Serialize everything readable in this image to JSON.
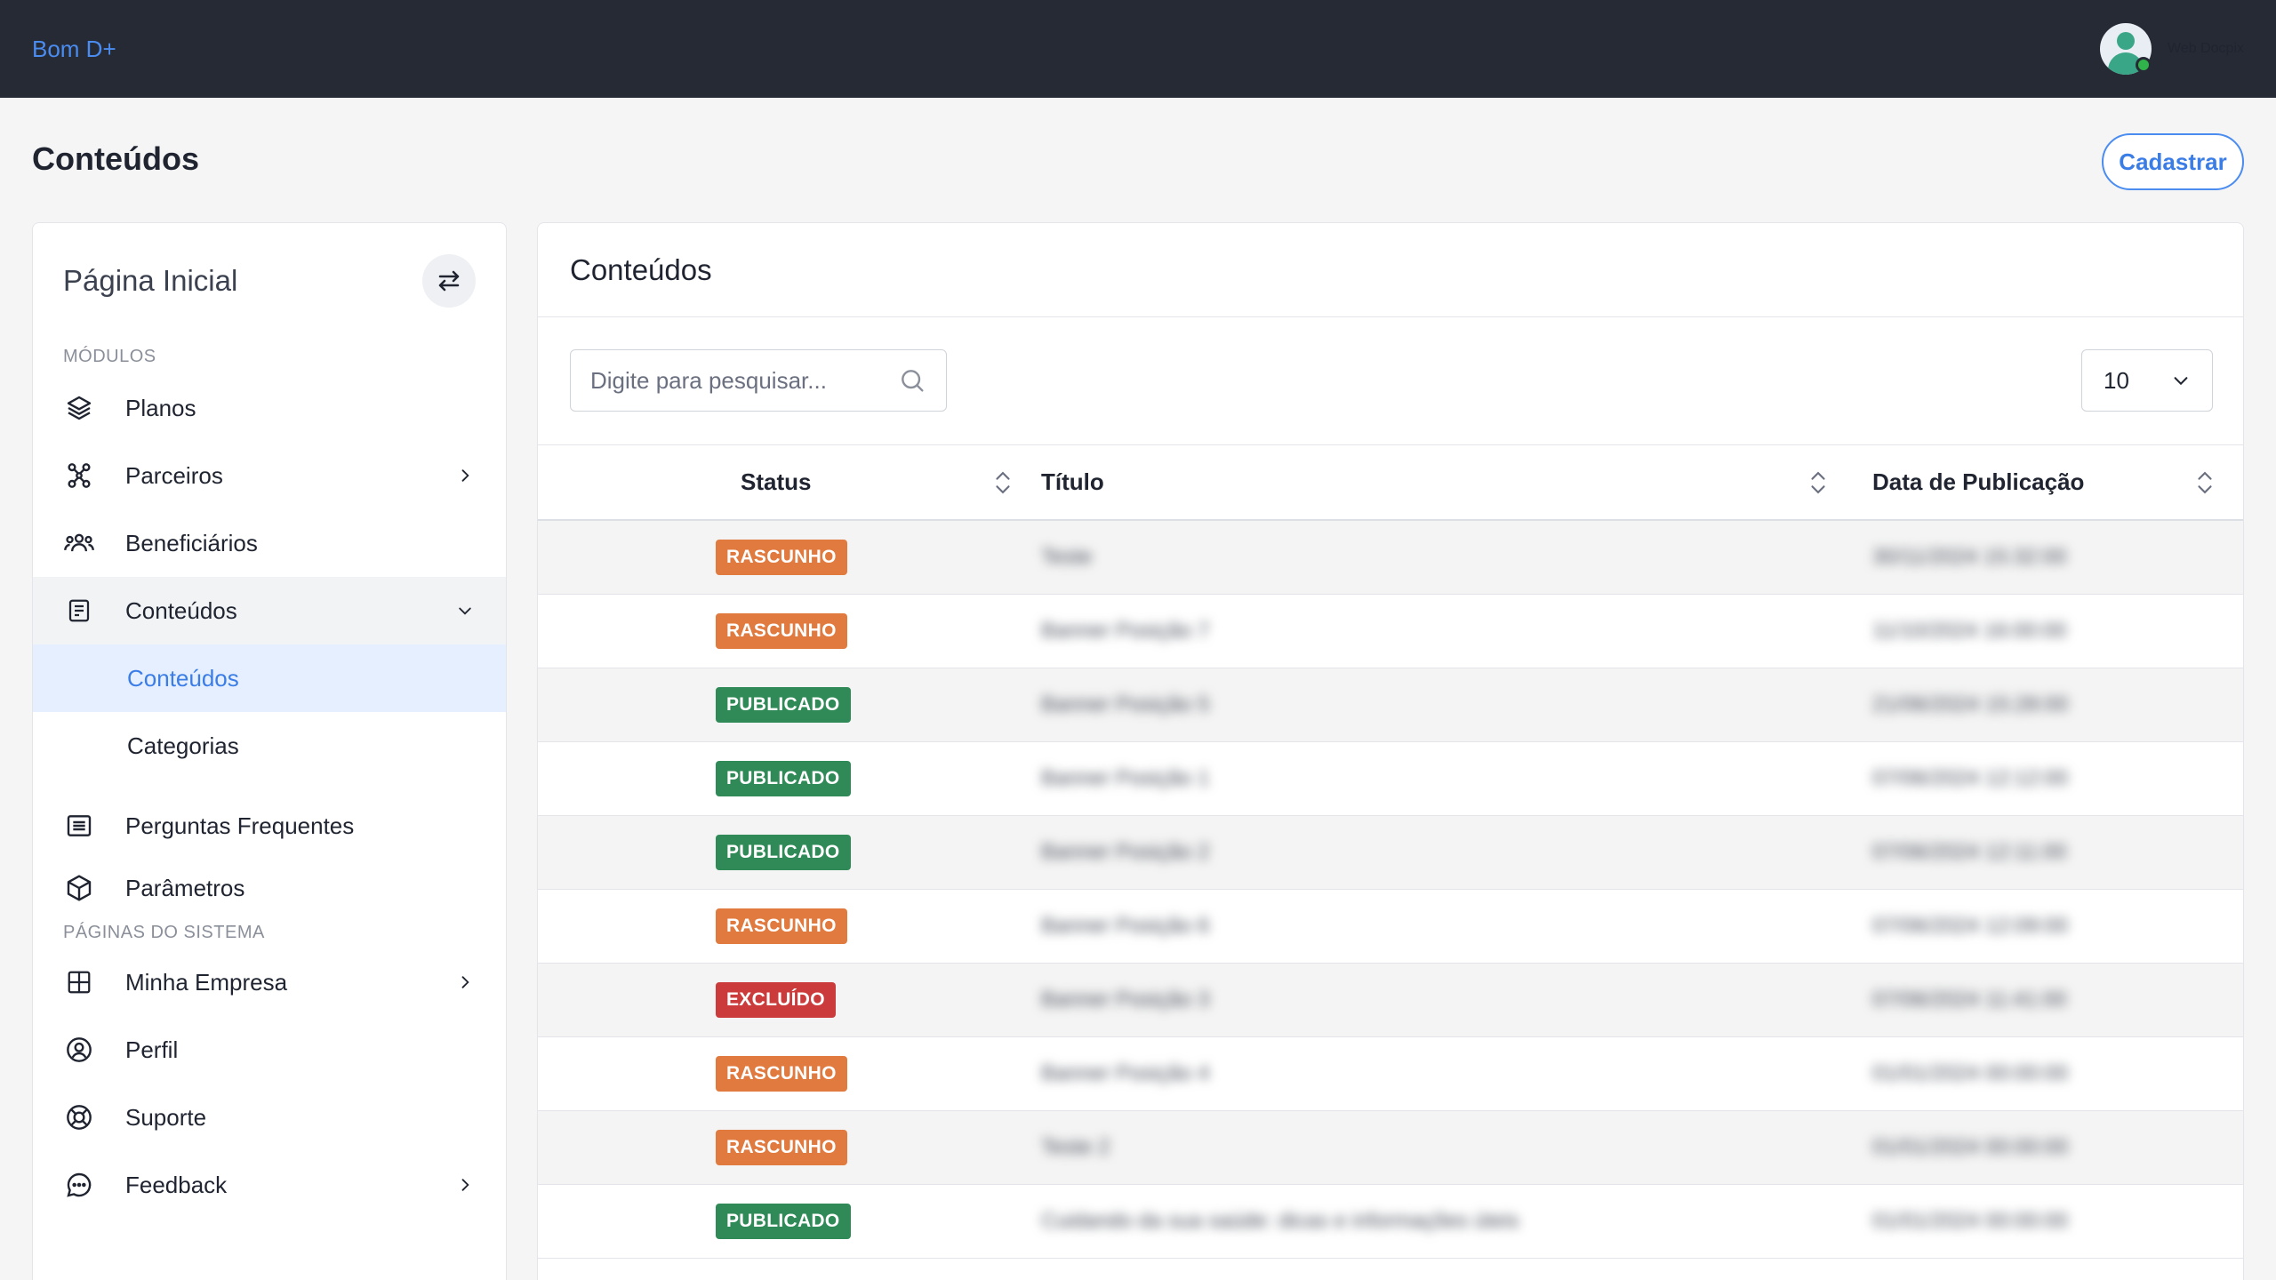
{
  "topbar": {
    "brand": "Bom D+",
    "user_name": "Web Docpix"
  },
  "page": {
    "title": "Conteúdos",
    "cadastrar_label": "Cadastrar"
  },
  "sidebar": {
    "title": "Página Inicial",
    "section_modules": "MÓDULOS",
    "section_system": "PÁGINAS DO SISTEMA",
    "items": {
      "planos": "Planos",
      "parceiros": "Parceiros",
      "beneficiarios": "Beneficiários",
      "conteudos": "Conteúdos",
      "sub_conteudos": "Conteúdos",
      "sub_categorias": "Categorias",
      "perguntas": "Perguntas Frequentes",
      "parametros": "Parâmetros",
      "empresa": "Minha Empresa",
      "perfil": "Perfil",
      "suporte": "Suporte",
      "feedback": "Feedback"
    }
  },
  "main": {
    "title": "Conteúdos",
    "search_placeholder": "Digite para pesquisar...",
    "page_size": "10",
    "columns": {
      "status": "Status",
      "titulo": "Título",
      "data": "Data de Publicação"
    },
    "rows": [
      {
        "status": "RASCUNHO",
        "titulo": "Teste",
        "data": "30/11/2024 15:32:00"
      },
      {
        "status": "RASCUNHO",
        "titulo": "Banner Posição 7",
        "data": "11/10/2024 16:00:00"
      },
      {
        "status": "PUBLICADO",
        "titulo": "Banner Posição 5",
        "data": "21/06/2024 15:28:00"
      },
      {
        "status": "PUBLICADO",
        "titulo": "Banner Posição 1",
        "data": "07/06/2024 12:12:00"
      },
      {
        "status": "PUBLICADO",
        "titulo": "Banner Posição 2",
        "data": "07/06/2024 12:11:00"
      },
      {
        "status": "RASCUNHO",
        "titulo": "Banner Posição 6",
        "data": "07/06/2024 12:09:00"
      },
      {
        "status": "EXCLUÍDO",
        "titulo": "Banner Posição 3",
        "data": "07/06/2024 11:41:00"
      },
      {
        "status": "RASCUNHO",
        "titulo": "Banner Posição 4",
        "data": "01/01/2024 00:00:00"
      },
      {
        "status": "RASCUNHO",
        "titulo": "Teste 2",
        "data": "01/01/2024 00:00:00"
      },
      {
        "status": "PUBLICADO",
        "titulo": "Cuidando da sua saúde: dicas e informações úteis",
        "data": "01/01/2024 00:00:00"
      }
    ]
  },
  "colors": {
    "topbar": "#262a35",
    "accent": "#4a8cf0",
    "rascunho": "#e07a3f",
    "publicado": "#2f8a57",
    "excluido": "#cc3b3b"
  }
}
